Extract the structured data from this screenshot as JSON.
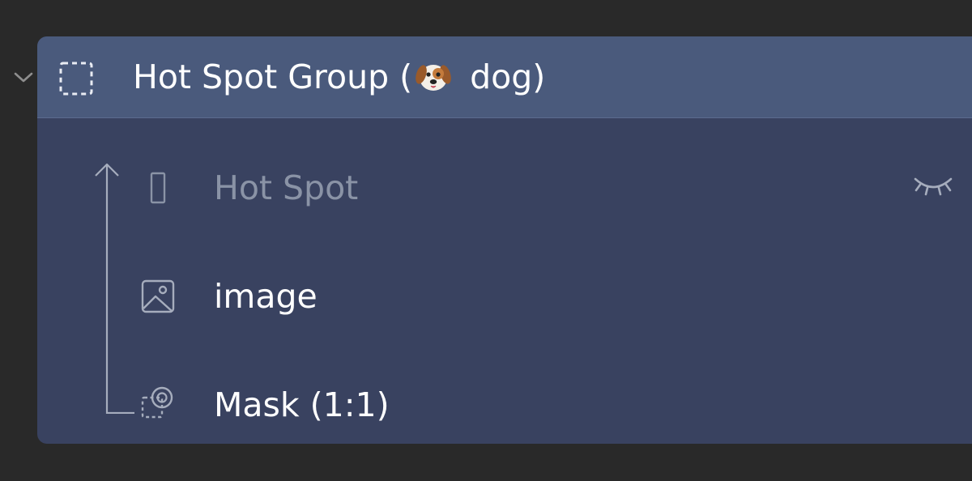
{
  "layer_panel": {
    "group": {
      "title_prefix": "Hot Spot Group (",
      "title_suffix": " dog)",
      "emoji": "dog-face-emoji",
      "expanded": true,
      "icon": "dashed-frame-icon"
    },
    "children": [
      {
        "label": "Hot Spot",
        "icon": "hotspot-rect-icon",
        "hidden": true,
        "status_icon": "eye-closed-icon"
      },
      {
        "label": "image",
        "icon": "image-icon",
        "hidden": false
      },
      {
        "label": "Mask (1:1)",
        "icon": "mask-icon",
        "hidden": false
      }
    ]
  },
  "colors": {
    "background": "#292929",
    "panel": "#394260",
    "header": "#4a5a7c",
    "text": "#ffffff",
    "dim_text": "#8a93a6",
    "icon": "#a6adbd"
  }
}
